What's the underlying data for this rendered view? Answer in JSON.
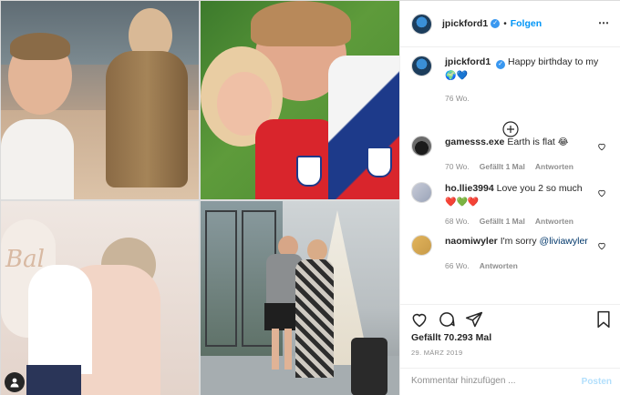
{
  "post": {
    "username": "jpickford1",
    "follow_label": "Folgen",
    "separator": "•",
    "more_icon": "more-options-icon",
    "verified_icon": "verified-badge-icon"
  },
  "caption": {
    "username": "jpickford1",
    "text": "Happy birthday to my",
    "emojis": "🌍💙",
    "time": "76 Wo."
  },
  "comments": [
    {
      "username": "gamesss.exe",
      "text": "Earth is flat",
      "emoji": "😂",
      "time": "70 Wo.",
      "likes": "Gefällt 1 Mal",
      "reply": "Antworten"
    },
    {
      "username": "ho.llie3994",
      "text": "Love you 2 so much",
      "emoji": "❤️💚❤️",
      "time": "68 Wo.",
      "likes": "Gefällt 1 Mal",
      "reply": "Antworten"
    },
    {
      "username": "naomiwyler",
      "text": "I'm sorry",
      "mention": "@liviawyler",
      "time": "66 Wo.",
      "reply": "Antworten"
    }
  ],
  "actions": {
    "likes_label": "Gefällt 70.293 Mal",
    "date": "29. MÄRZ 2019"
  },
  "add_comment": {
    "placeholder": "Kommentar hinzufügen ...",
    "post_label": "Posten"
  },
  "colors": {
    "link_blue": "#0095f6",
    "verified_blue": "#3897f0",
    "muted_gray": "#8e8e8e",
    "post_disabled": "#b2dffc"
  }
}
